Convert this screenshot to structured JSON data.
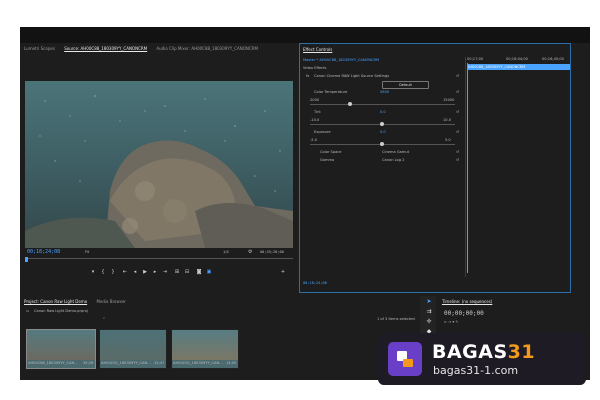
{
  "source_monitor": {
    "tabs": [
      "Lumetri Scopes",
      "Source: AH00C88_180309YY_CANONCRM",
      "Audio Clip Mixer: AH00C88_180309YY_CANONCRM"
    ],
    "timecode": "00;18;24;08",
    "fit": "Fit",
    "resolution": "1/4",
    "duration_display": "00;35;28;00"
  },
  "effect_controls": {
    "title": "Effect Controls",
    "master_label": "Master * AH00C88_180309YY_CANONCRM",
    "clip_label": "AH00C88_180309YY_CANONCRM",
    "video_effects_label": "Video Effects",
    "effect_name": "Canon Cinema RAW Light Source Settings",
    "default_button": "Default",
    "color_temperature": {
      "label": "Color Temperature",
      "value": "5600",
      "min": "2000",
      "max": "15000"
    },
    "tint": {
      "label": "Tint",
      "value": "0.0",
      "min": "-10.0",
      "max": "10.0"
    },
    "exposure": {
      "label": "Exposure",
      "value": "0.0",
      "min": "-5.0",
      "max": "5.0"
    },
    "color_space": {
      "label": "Color Space",
      "value": "Cinema Gamut"
    },
    "gamma": {
      "label": "Gamma",
      "value": "Canon Log 2"
    },
    "timeline_ruler": [
      "00;17;00",
      "00;18;04;00",
      "00;18;45;00"
    ],
    "bottom_timecode": "00;18;24;08"
  },
  "project": {
    "tabs": [
      "Project: Canon Raw Light Demo",
      "Media Browser"
    ],
    "folder": "Canon Raw Light Demo.prproj",
    "items_selected": "1 of 3 items selected",
    "clips": [
      {
        "name": "AH00C88_180309YY_CAN...",
        "duration": "35;28"
      },
      {
        "name": "AH00C92_180309YY_CAN...",
        "duration": "15;47"
      },
      {
        "name": "AH00C92_180309YY_CAN...",
        "duration": "14;00"
      }
    ]
  },
  "timeline": {
    "title": "Timeline: (no sequences)",
    "timecode": "00;00;00;00"
  },
  "watermark": {
    "brand_main": "BAGAS",
    "brand_num": "31",
    "url": "bagas31-1.com"
  },
  "colors": {
    "accent": "#4aa3ff",
    "brand_orange": "#f39a1e",
    "logo_bg": "#6a3fc8"
  }
}
